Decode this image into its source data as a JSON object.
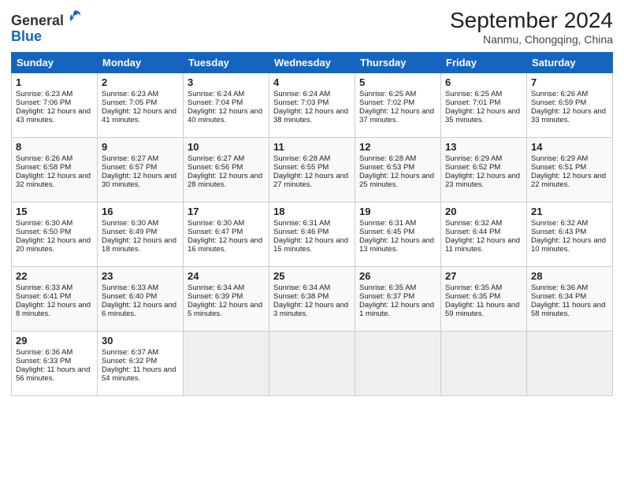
{
  "header": {
    "logo_line1": "General",
    "logo_line2": "Blue",
    "month": "September 2024",
    "location": "Nanmu, Chongqing, China"
  },
  "weekdays": [
    "Sunday",
    "Monday",
    "Tuesday",
    "Wednesday",
    "Thursday",
    "Friday",
    "Saturday"
  ],
  "weeks": [
    [
      {
        "day": "1",
        "sunrise": "Sunrise: 6:23 AM",
        "sunset": "Sunset: 7:06 PM",
        "daylight": "Daylight: 12 hours and 43 minutes."
      },
      {
        "day": "2",
        "sunrise": "Sunrise: 6:23 AM",
        "sunset": "Sunset: 7:05 PM",
        "daylight": "Daylight: 12 hours and 41 minutes."
      },
      {
        "day": "3",
        "sunrise": "Sunrise: 6:24 AM",
        "sunset": "Sunset: 7:04 PM",
        "daylight": "Daylight: 12 hours and 40 minutes."
      },
      {
        "day": "4",
        "sunrise": "Sunrise: 6:24 AM",
        "sunset": "Sunset: 7:03 PM",
        "daylight": "Daylight: 12 hours and 38 minutes."
      },
      {
        "day": "5",
        "sunrise": "Sunrise: 6:25 AM",
        "sunset": "Sunset: 7:02 PM",
        "daylight": "Daylight: 12 hours and 37 minutes."
      },
      {
        "day": "6",
        "sunrise": "Sunrise: 6:25 AM",
        "sunset": "Sunset: 7:01 PM",
        "daylight": "Daylight: 12 hours and 35 minutes."
      },
      {
        "day": "7",
        "sunrise": "Sunrise: 6:26 AM",
        "sunset": "Sunset: 6:59 PM",
        "daylight": "Daylight: 12 hours and 33 minutes."
      }
    ],
    [
      {
        "day": "8",
        "sunrise": "Sunrise: 6:26 AM",
        "sunset": "Sunset: 6:58 PM",
        "daylight": "Daylight: 12 hours and 32 minutes."
      },
      {
        "day": "9",
        "sunrise": "Sunrise: 6:27 AM",
        "sunset": "Sunset: 6:57 PM",
        "daylight": "Daylight: 12 hours and 30 minutes."
      },
      {
        "day": "10",
        "sunrise": "Sunrise: 6:27 AM",
        "sunset": "Sunset: 6:56 PM",
        "daylight": "Daylight: 12 hours and 28 minutes."
      },
      {
        "day": "11",
        "sunrise": "Sunrise: 6:28 AM",
        "sunset": "Sunset: 6:55 PM",
        "daylight": "Daylight: 12 hours and 27 minutes."
      },
      {
        "day": "12",
        "sunrise": "Sunrise: 6:28 AM",
        "sunset": "Sunset: 6:53 PM",
        "daylight": "Daylight: 12 hours and 25 minutes."
      },
      {
        "day": "13",
        "sunrise": "Sunrise: 6:29 AM",
        "sunset": "Sunset: 6:52 PM",
        "daylight": "Daylight: 12 hours and 23 minutes."
      },
      {
        "day": "14",
        "sunrise": "Sunrise: 6:29 AM",
        "sunset": "Sunset: 6:51 PM",
        "daylight": "Daylight: 12 hours and 22 minutes."
      }
    ],
    [
      {
        "day": "15",
        "sunrise": "Sunrise: 6:30 AM",
        "sunset": "Sunset: 6:50 PM",
        "daylight": "Daylight: 12 hours and 20 minutes."
      },
      {
        "day": "16",
        "sunrise": "Sunrise: 6:30 AM",
        "sunset": "Sunset: 6:49 PM",
        "daylight": "Daylight: 12 hours and 18 minutes."
      },
      {
        "day": "17",
        "sunrise": "Sunrise: 6:30 AM",
        "sunset": "Sunset: 6:47 PM",
        "daylight": "Daylight: 12 hours and 16 minutes."
      },
      {
        "day": "18",
        "sunrise": "Sunrise: 6:31 AM",
        "sunset": "Sunset: 6:46 PM",
        "daylight": "Daylight: 12 hours and 15 minutes."
      },
      {
        "day": "19",
        "sunrise": "Sunrise: 6:31 AM",
        "sunset": "Sunset: 6:45 PM",
        "daylight": "Daylight: 12 hours and 13 minutes."
      },
      {
        "day": "20",
        "sunrise": "Sunrise: 6:32 AM",
        "sunset": "Sunset: 6:44 PM",
        "daylight": "Daylight: 12 hours and 11 minutes."
      },
      {
        "day": "21",
        "sunrise": "Sunrise: 6:32 AM",
        "sunset": "Sunset: 6:43 PM",
        "daylight": "Daylight: 12 hours and 10 minutes."
      }
    ],
    [
      {
        "day": "22",
        "sunrise": "Sunrise: 6:33 AM",
        "sunset": "Sunset: 6:41 PM",
        "daylight": "Daylight: 12 hours and 8 minutes."
      },
      {
        "day": "23",
        "sunrise": "Sunrise: 6:33 AM",
        "sunset": "Sunset: 6:40 PM",
        "daylight": "Daylight: 12 hours and 6 minutes."
      },
      {
        "day": "24",
        "sunrise": "Sunrise: 6:34 AM",
        "sunset": "Sunset: 6:39 PM",
        "daylight": "Daylight: 12 hours and 5 minutes."
      },
      {
        "day": "25",
        "sunrise": "Sunrise: 6:34 AM",
        "sunset": "Sunset: 6:38 PM",
        "daylight": "Daylight: 12 hours and 3 minutes."
      },
      {
        "day": "26",
        "sunrise": "Sunrise: 6:35 AM",
        "sunset": "Sunset: 6:37 PM",
        "daylight": "Daylight: 12 hours and 1 minute."
      },
      {
        "day": "27",
        "sunrise": "Sunrise: 6:35 AM",
        "sunset": "Sunset: 6:35 PM",
        "daylight": "Daylight: 11 hours and 59 minutes."
      },
      {
        "day": "28",
        "sunrise": "Sunrise: 6:36 AM",
        "sunset": "Sunset: 6:34 PM",
        "daylight": "Daylight: 11 hours and 58 minutes."
      }
    ],
    [
      {
        "day": "29",
        "sunrise": "Sunrise: 6:36 AM",
        "sunset": "Sunset: 6:33 PM",
        "daylight": "Daylight: 11 hours and 56 minutes."
      },
      {
        "day": "30",
        "sunrise": "Sunrise: 6:37 AM",
        "sunset": "Sunset: 6:32 PM",
        "daylight": "Daylight: 11 hours and 54 minutes."
      },
      null,
      null,
      null,
      null,
      null
    ]
  ]
}
